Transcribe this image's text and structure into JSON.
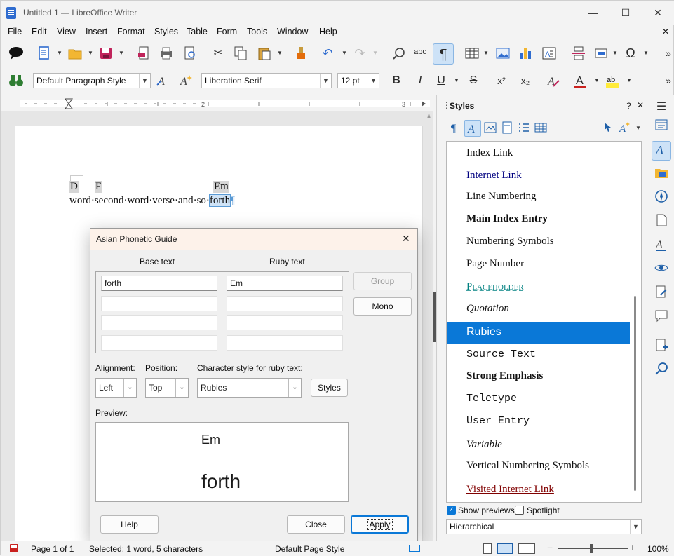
{
  "window": {
    "title": "Untitled 1 — LibreOffice Writer",
    "minimize_glyph": "—",
    "maximize_glyph": "☐",
    "close_glyph": "✕"
  },
  "menu": [
    "File",
    "Edit",
    "View",
    "Insert",
    "Format",
    "Styles",
    "Table",
    "Form",
    "Tools",
    "Window",
    "Help"
  ],
  "menu_close_glyph": "✕",
  "formatting": {
    "paragraph_style": "Default Paragraph Style",
    "font_name": "Liberation Serif",
    "font_size": "12 pt",
    "bold": "B",
    "italic": "I",
    "underline": "U",
    "strike": "S",
    "superscript": "x²",
    "subscript": "x₂"
  },
  "document": {
    "ruby_line": [
      "D",
      "F",
      "Em"
    ],
    "text_line": "word·second·word·verse·and·so·",
    "selected_word": "forth",
    "pilcrow": "¶"
  },
  "styles_panel": {
    "title": "Styles",
    "help_glyph": "?",
    "close_glyph": "✕",
    "menu_glyph": "☰",
    "items": [
      {
        "label": "Index Link"
      },
      {
        "label": "Internet Link"
      },
      {
        "label": "Line Numbering"
      },
      {
        "label": "Main Index Entry"
      },
      {
        "label": "Numbering Symbols"
      },
      {
        "label": "Page Number"
      },
      {
        "label": "Placeholder"
      },
      {
        "label": "Quotation"
      },
      {
        "label": "Rubies"
      },
      {
        "label": "Source Text"
      },
      {
        "label": "Strong Emphasis"
      },
      {
        "label": "Teletype"
      },
      {
        "label": "User Entry"
      },
      {
        "label": "Variable"
      },
      {
        "label": "Vertical Numbering Symbols"
      },
      {
        "label": "Visited Internet Link"
      }
    ],
    "selected": "Rubies",
    "show_previews_label": "Show previews",
    "show_previews_checked": true,
    "spotlight_label": "Spotlight",
    "spotlight_checked": false,
    "filter": "Hierarchical"
  },
  "dialog": {
    "title": "Asian Phonetic Guide",
    "close_glyph": "✕",
    "base_text_header": "Base text",
    "ruby_text_header": "Ruby text",
    "rows": [
      {
        "base": "forth",
        "ruby": "Em"
      },
      {
        "base": "",
        "ruby": ""
      },
      {
        "base": "",
        "ruby": ""
      },
      {
        "base": "",
        "ruby": ""
      }
    ],
    "group_button": "Group",
    "mono_button": "Mono",
    "alignment_label": "Alignment:",
    "alignment_value": "Left",
    "position_label": "Position:",
    "position_value": "Top",
    "char_style_label": "Character style for ruby text:",
    "char_style_value": "Rubies",
    "styles_button": "Styles",
    "preview_label": "Preview:",
    "preview_ruby": "Em",
    "preview_base": "forth",
    "help_button": "Help",
    "close_button": "Close",
    "apply_button": "Apply"
  },
  "status": {
    "page": "Page 1 of 1",
    "selection": "Selected: 1 word, 5 characters",
    "page_style": "Default Page Style",
    "zoom": "100%",
    "zoom_out": "−",
    "zoom_in": "+"
  },
  "colors": {
    "accent": "#0a78d7",
    "link": "#000080",
    "visited": "#800000",
    "placeholder": "#008080"
  }
}
